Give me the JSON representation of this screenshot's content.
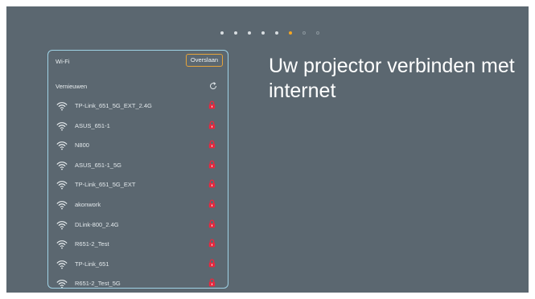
{
  "progress": {
    "total_steps": 8,
    "current_step": 6,
    "colors": {
      "done": "#d8dde0",
      "active": "#f5a623",
      "todo": "#8a959c"
    }
  },
  "panel": {
    "title": "Wi-Fi",
    "skip_label": "Overslaan",
    "refresh_label": "Vernieuwen",
    "refresh_icon": "refresh-icon",
    "networks": [
      {
        "name": "TP-Link_651_5G_EXT_2.4G",
        "secured": true
      },
      {
        "name": "ASUS_651-1",
        "secured": true
      },
      {
        "name": "N800",
        "secured": true
      },
      {
        "name": "ASUS_651-1_5G",
        "secured": true
      },
      {
        "name": "TP-Link_651_5G_EXT",
        "secured": true
      },
      {
        "name": "akonwork",
        "secured": true
      },
      {
        "name": "DLink-800_2.4G",
        "secured": true
      },
      {
        "name": "R651-2_Test",
        "secured": true
      },
      {
        "name": "TP-Link_651",
        "secured": true
      },
      {
        "name": "R651-2_Test_5G",
        "secured": true
      }
    ]
  },
  "heading": "Uw projector verbinden met internet",
  "colors": {
    "background": "#5b6770",
    "panel_border": "#9fd3e6",
    "accent": "#e6a43a",
    "lock": "#e8293f"
  }
}
